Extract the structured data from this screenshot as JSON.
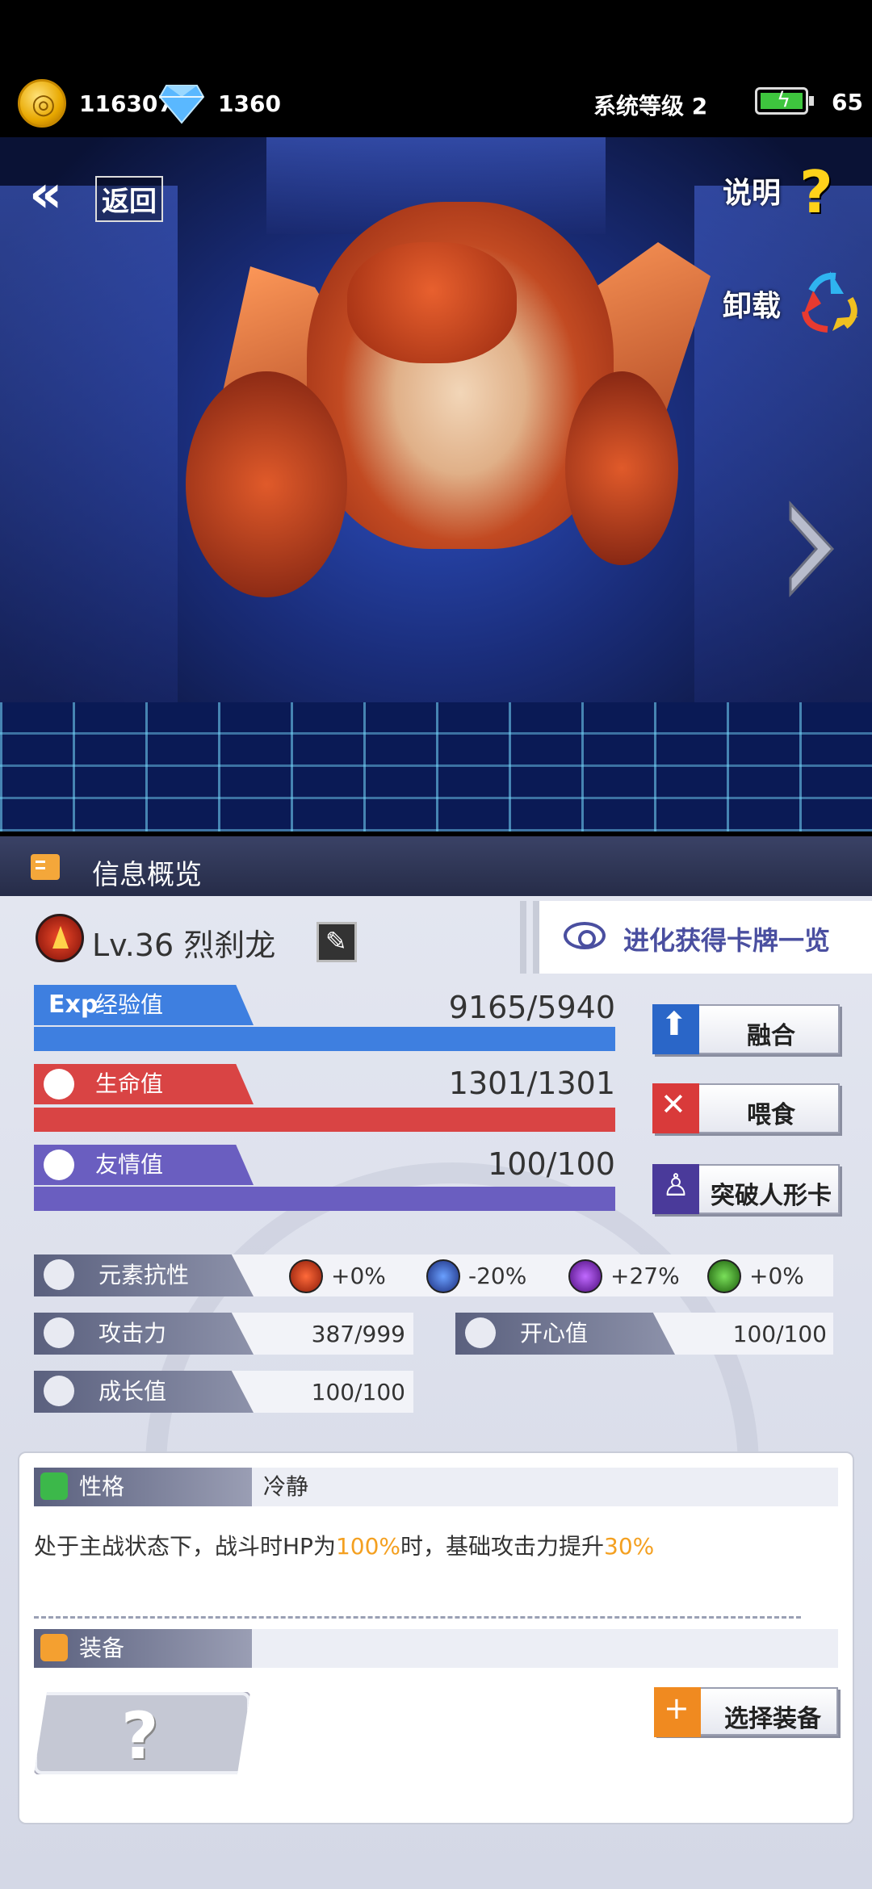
{
  "status_bar": {
    "gold": "116307",
    "gems": "1360",
    "system_level": "系统等级 2",
    "energy": "65",
    "icons": [
      "coin-icon",
      "diamond-icon",
      "battery-icon"
    ]
  },
  "scene": {
    "back_label": "返回",
    "help_label": "说明",
    "help_glyph": "?",
    "uninstall_label": "卸载"
  },
  "info_bar": {
    "title": "信息概览"
  },
  "pet": {
    "name": "Lv.36 烈刹龙",
    "evolution_button": "进化获得卡牌一览"
  },
  "stats": [
    {
      "tag_glyph": "Exp",
      "label": "经验值",
      "value": "9165/5940",
      "fill": 1.0,
      "color": "#3e7fe0"
    },
    {
      "label": "生命值",
      "value": "1301/1301",
      "fill": 1.0,
      "color": "#d94444"
    },
    {
      "label": "友情值",
      "value": "100/100",
      "fill": 1.0,
      "color": "#6a5ec0"
    }
  ],
  "actions": [
    {
      "label": "融合",
      "icon": "level-up-icon",
      "color": "#2a66c8"
    },
    {
      "label": "喂食",
      "icon": "fork-knife-icon",
      "color": "#d93a3a"
    },
    {
      "label": "突破人形卡",
      "icon": "person-icon",
      "color": "#4a3a9a"
    }
  ],
  "resistance": {
    "label": "元素抗性",
    "items": [
      {
        "value": "+0%",
        "icon": "fire-element-icon"
      },
      {
        "value": "-20%",
        "icon": "water-element-icon"
      },
      {
        "value": "+27%",
        "icon": "thunder-element-icon"
      },
      {
        "value": "+0%",
        "icon": "nature-element-icon"
      }
    ]
  },
  "attributes": {
    "attack": {
      "label": "攻击力",
      "value": "387/999"
    },
    "happiness": {
      "label": "开心值",
      "value": "100/100"
    },
    "growth": {
      "label": "成长值",
      "value": "100/100"
    }
  },
  "trait": {
    "label": "性格",
    "value": "冷静",
    "desc_1": "处于主战状态下，战斗时HP为",
    "desc_hl_1": "100%",
    "desc_2": "时，基础攻击力提升",
    "desc_hl_2": "30%"
  },
  "equipment": {
    "label": "装备",
    "slot_glyph": "?",
    "select_button": "选择装备"
  }
}
